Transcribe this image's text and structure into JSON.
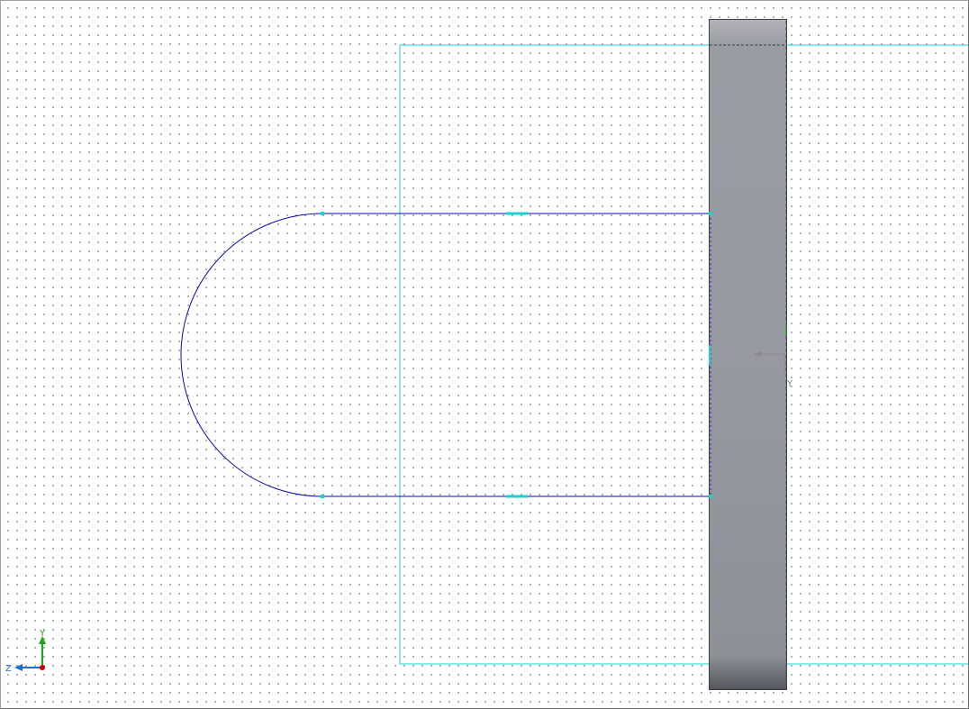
{
  "viewport": {
    "background": "#ffffff",
    "grid_dot_color": "#8e8e8e"
  },
  "colors": {
    "sketch_line": "#0a0aa8",
    "sketch_point": "#19d3d3",
    "plane_outline": "#19d3d3",
    "relation_marker": "#19d3d3",
    "body_fill_top": "#b2b3bb",
    "body_fill_mid": "#9699a1",
    "body_fill_bottom": "#55575e",
    "body_edge": "#3c3e44",
    "axis_x": "#d40000",
    "axis_y": "#1aa81a",
    "axis_z": "#1f6fd0"
  },
  "sketch": {
    "entities": [
      "arc",
      "top-line",
      "bottom-line"
    ],
    "relations": [
      "horizontal",
      "horizontal"
    ]
  },
  "sketch_origin": {
    "y_label": "Y"
  },
  "triad": {
    "y_label": "Y",
    "z_label": "Z",
    "icon": "reference-triad-icon"
  }
}
